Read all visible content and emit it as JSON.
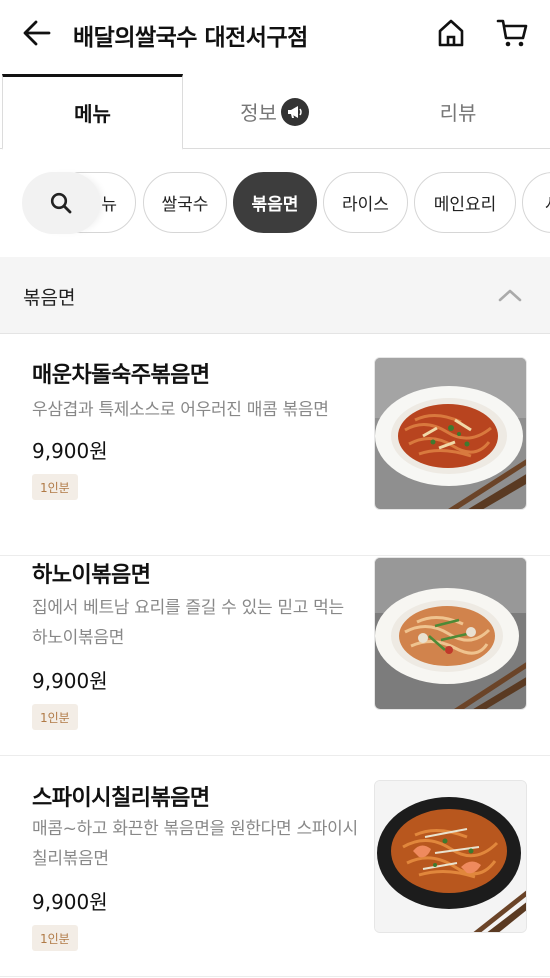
{
  "header": {
    "title": "배달의쌀국수 대전서구점",
    "back_icon": "arrow-left-icon",
    "home_icon": "home-icon",
    "cart_icon": "cart-icon"
  },
  "tabs": [
    {
      "label": "메뉴",
      "active": true
    },
    {
      "label": "정보",
      "active": false,
      "icon": "megaphone-icon"
    },
    {
      "label": "리뷰",
      "active": false
    }
  ],
  "search": {
    "icon": "search-icon"
  },
  "categories": [
    {
      "label": "뉴",
      "active": false
    },
    {
      "label": "쌀국수",
      "active": false
    },
    {
      "label": "볶음면",
      "active": true
    },
    {
      "label": "라이스",
      "active": false
    },
    {
      "label": "메인요리",
      "active": false
    },
    {
      "label": "사",
      "active": false
    }
  ],
  "section": {
    "title": "볶음면",
    "expanded": true,
    "icon": "chevron-up-icon"
  },
  "items": [
    {
      "name": "매운차돌숙주볶음면",
      "description": "우삼겹과 특제소스로 어우러진 매콤 볶음면",
      "price": "9,900원",
      "badge": "1인분",
      "photo": "spicy-beef-noodle-photo"
    },
    {
      "name": "하노이볶음면",
      "description": "집에서 베트남 요리를 즐길 수 있는 믿고 먹는 하노이볶음면",
      "price": "9,900원",
      "badge": "1인분",
      "photo": "hanoi-noodle-photo"
    },
    {
      "name": "스파이시칠리볶음면",
      "description": "매콤~하고 화끈한 볶음면을 원한다면 스파이시 칠리볶음면",
      "price": "9,900원",
      "badge": "1인분",
      "photo": "chili-shrimp-noodle-photo"
    }
  ],
  "colors": {
    "accent_dark": "#3d3d3d",
    "badge_bg": "#f3ede6",
    "badge_text": "#b07a46",
    "section_bg": "#f5f5f5"
  }
}
